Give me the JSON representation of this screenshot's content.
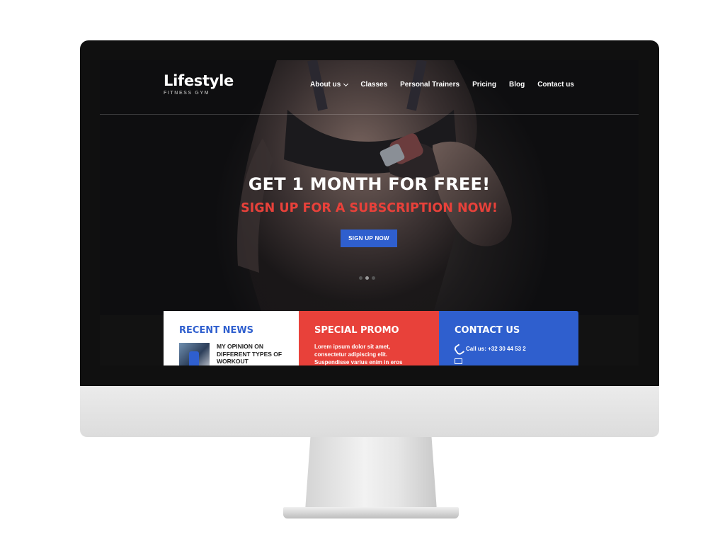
{
  "brand": {
    "title": "Lifestyle",
    "subtitle": "FITNESS GYM"
  },
  "nav": {
    "items": [
      {
        "label": "About us",
        "has_dropdown": true
      },
      {
        "label": "Classes"
      },
      {
        "label": "Personal Trainers"
      },
      {
        "label": "Pricing"
      },
      {
        "label": "Blog"
      },
      {
        "label": "Contact us"
      }
    ]
  },
  "hero": {
    "title": "GET 1 MONTH FOR FREE!",
    "subtitle": "SIGN UP FOR A SUBSCRIPTION NOW!",
    "cta_label": "SIGN UP NOW",
    "slides_count": 3,
    "active_slide": 2
  },
  "cards": {
    "news": {
      "title": "RECENT NEWS",
      "item_headline": "MY OPINION ON DIFFERENT TYPES OF WORKOUT"
    },
    "promo": {
      "title": "SPECIAL PROMO",
      "text": "Lorem ipsum dolor sit amet, consectetur adipiscing elit. Suspendisse varius enim in eros"
    },
    "contact": {
      "title": "CONTACT US",
      "phone": "Call us: +32 30 44 53 2"
    }
  },
  "colors": {
    "accent_blue": "#2f5fce",
    "accent_red": "#e8413a",
    "hero_dark": "#121212"
  },
  "icons": [
    "chevron-down-icon",
    "phone-icon",
    "mail-icon"
  ]
}
